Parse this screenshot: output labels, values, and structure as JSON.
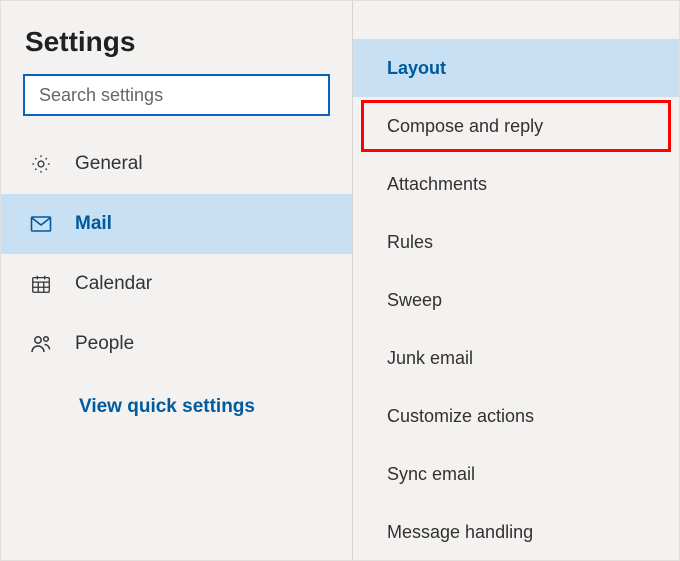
{
  "page_title": "Settings",
  "search": {
    "placeholder": "Search settings"
  },
  "nav": {
    "items": [
      {
        "label": "General",
        "icon": "gear-icon",
        "selected": false
      },
      {
        "label": "Mail",
        "icon": "mail-icon",
        "selected": true
      },
      {
        "label": "Calendar",
        "icon": "calendar-icon",
        "selected": false
      },
      {
        "label": "People",
        "icon": "people-icon",
        "selected": false
      }
    ],
    "quick_link": "View quick settings"
  },
  "sub_nav": {
    "items": [
      {
        "label": "Layout",
        "selected": true,
        "highlighted": false
      },
      {
        "label": "Compose and reply",
        "selected": false,
        "highlighted": true
      },
      {
        "label": "Attachments",
        "selected": false,
        "highlighted": false
      },
      {
        "label": "Rules",
        "selected": false,
        "highlighted": false
      },
      {
        "label": "Sweep",
        "selected": false,
        "highlighted": false
      },
      {
        "label": "Junk email",
        "selected": false,
        "highlighted": false
      },
      {
        "label": "Customize actions",
        "selected": false,
        "highlighted": false
      },
      {
        "label": "Sync email",
        "selected": false,
        "highlighted": false
      },
      {
        "label": "Message handling",
        "selected": false,
        "highlighted": false
      }
    ]
  },
  "colors": {
    "accent": "#005a9e",
    "selected_bg": "#c7e0f4",
    "highlight_outline": "#ff0000"
  }
}
